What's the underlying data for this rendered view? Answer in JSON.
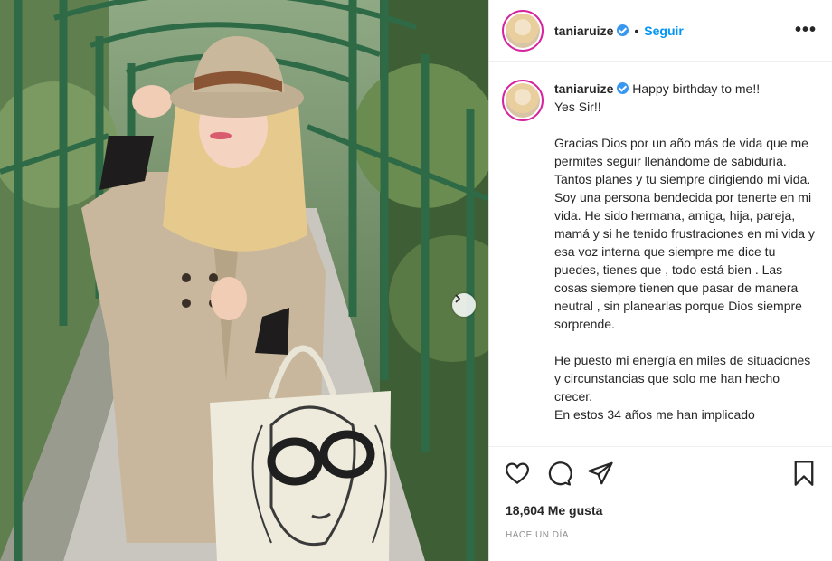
{
  "post": {
    "username": "taniaruize",
    "follow_label": "Seguir",
    "separator": "•",
    "more_label": "•••",
    "caption": {
      "first_line": "Happy birthday to me!!",
      "body": "Yes Sir!!\n\nGracias Dios por un año más de vida que me permites seguir llenándome de sabiduría. Tantos planes y tu siempre dirigiendo mi vida. Soy una persona bendecida por tenerte en mi vida. He sido hermana, amiga, hija, pareja, mamá y si he tenido frustraciones en mi vida y esa voz interna que siempre me dice tu puedes, tienes que , todo está bien . Las cosas siempre tienen que pasar de manera neutral , sin planearlas porque Dios siempre sorprende.\n\nHe puesto mi energía en miles de situaciones y circunstancias que solo me han hecho crecer.\nEn estos 34 años me han implicado"
    },
    "likes": "18,604 Me gusta",
    "time": "HACE UN DÍA"
  },
  "icons": {
    "like": "heart-icon",
    "comment": "comment-icon",
    "share": "paper-plane-icon",
    "save": "bookmark-icon",
    "verified": "verified-badge-icon",
    "next": "chevron-right-icon"
  },
  "colors": {
    "accent": "#0095f6",
    "verified": "#3897f0",
    "muted": "#8e8e8e"
  }
}
